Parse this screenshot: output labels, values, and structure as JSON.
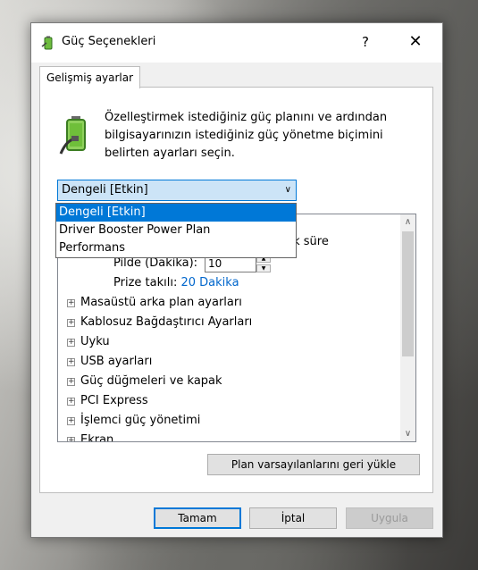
{
  "window": {
    "title": "Güç Seçenekleri",
    "help_label": "?",
    "close_label": "✕"
  },
  "tab": {
    "label": "Gelişmiş ayarlar"
  },
  "description": "Özelleştirmek istediğiniz güç planını ve ardından bilgisayarınızın istediğiniz güç yönetme biçimini belirten ayarları seçin.",
  "plan_select": {
    "value": "Dengeli [Etkin]",
    "options": [
      "Dengeli [Etkin]",
      "Driver Booster Power Plan",
      "Performans"
    ],
    "selected_index": 0
  },
  "tree": {
    "partial_text": "tek süre",
    "on_battery_label": "Pilde (Dakika):",
    "on_battery_value": "10",
    "plugged_in_label": "Prize takılı:",
    "plugged_in_value": "20 Dakika",
    "items": [
      "Masaüstü arka plan ayarları",
      "Kablosuz Bağdaştırıcı Ayarları",
      "Uyku",
      "USB ayarları",
      "Güç düğmeleri ve kapak",
      "PCI Express",
      "İşlemci güç yönetimi",
      "Ekran"
    ],
    "expander_glyph": "+"
  },
  "buttons": {
    "restore_defaults": "Plan varsayılanlarını geri yükle",
    "ok": "Tamam",
    "cancel": "İptal",
    "apply": "Uygula"
  },
  "colors": {
    "accent": "#0078d7",
    "selection_bg": "#cce4f7",
    "link": "#0066cc"
  },
  "icons": {
    "app": "power-options-icon",
    "battery": "battery-plug-icon"
  }
}
